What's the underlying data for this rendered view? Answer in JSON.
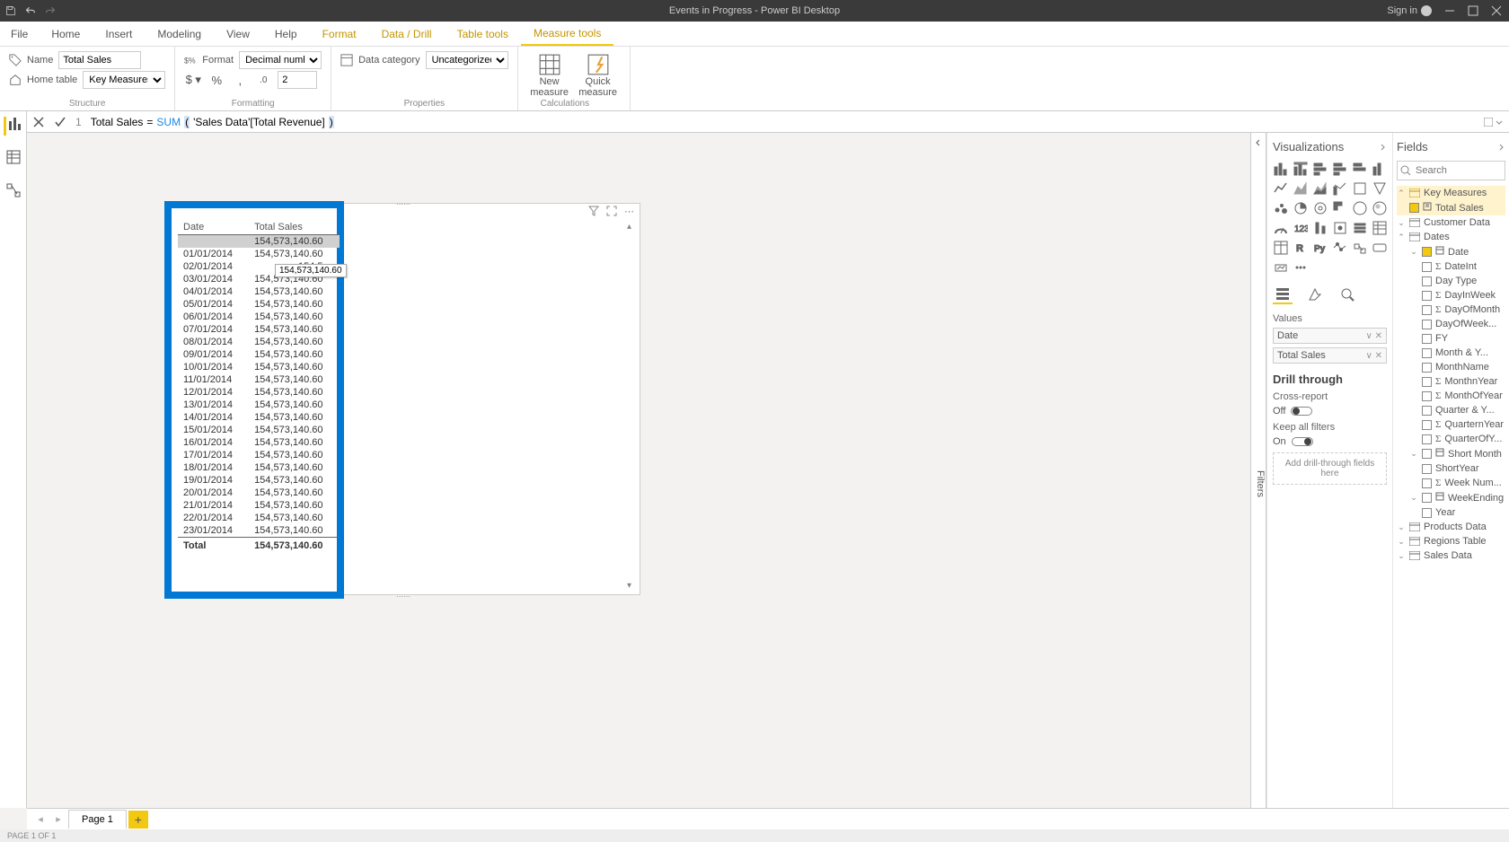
{
  "title_bar": {
    "title": "Events in Progress - Power BI Desktop",
    "sign_in": "Sign in"
  },
  "ribbon_tabs": {
    "file": "File",
    "home": "Home",
    "insert": "Insert",
    "modeling": "Modeling",
    "view": "View",
    "help": "Help",
    "format": "Format",
    "data_drill": "Data / Drill",
    "table_tools": "Table tools",
    "measure_tools": "Measure tools"
  },
  "ribbon": {
    "structure": {
      "name_label": "Name",
      "name_value": "Total Sales",
      "home_table_label": "Home table",
      "home_table_value": "Key Measures",
      "group": "Structure"
    },
    "formatting": {
      "format_label": "Format",
      "format_value": "Decimal number",
      "decimals": "2",
      "group": "Formatting"
    },
    "properties": {
      "data_cat_label": "Data category",
      "data_cat_value": "Uncategorized",
      "group": "Properties"
    },
    "calculations": {
      "new_measure": "New measure",
      "quick_measure": "Quick measure",
      "group": "Calculations"
    }
  },
  "formula": {
    "line": "1",
    "measure_name": "Total Sales",
    "eq": " = ",
    "func": "SUM",
    "open": "(",
    "arg": " 'Sales Data'[Total Revenue] ",
    "close": ")"
  },
  "visual": {
    "columns": {
      "date": "Date",
      "total_sales": "Total Sales"
    },
    "rows": [
      {
        "date": "",
        "value": "154,573,140.60",
        "selected": true
      },
      {
        "date": "01/01/2014",
        "value": "154,573,140.60"
      },
      {
        "date": "02/01/2014",
        "value": "154,5"
      },
      {
        "date": "03/01/2014",
        "value": "154,573,140.60"
      },
      {
        "date": "04/01/2014",
        "value": "154,573,140.60"
      },
      {
        "date": "05/01/2014",
        "value": "154,573,140.60"
      },
      {
        "date": "06/01/2014",
        "value": "154,573,140.60"
      },
      {
        "date": "07/01/2014",
        "value": "154,573,140.60"
      },
      {
        "date": "08/01/2014",
        "value": "154,573,140.60"
      },
      {
        "date": "09/01/2014",
        "value": "154,573,140.60"
      },
      {
        "date": "10/01/2014",
        "value": "154,573,140.60"
      },
      {
        "date": "11/01/2014",
        "value": "154,573,140.60"
      },
      {
        "date": "12/01/2014",
        "value": "154,573,140.60"
      },
      {
        "date": "13/01/2014",
        "value": "154,573,140.60"
      },
      {
        "date": "14/01/2014",
        "value": "154,573,140.60"
      },
      {
        "date": "15/01/2014",
        "value": "154,573,140.60"
      },
      {
        "date": "16/01/2014",
        "value": "154,573,140.60"
      },
      {
        "date": "17/01/2014",
        "value": "154,573,140.60"
      },
      {
        "date": "18/01/2014",
        "value": "154,573,140.60"
      },
      {
        "date": "19/01/2014",
        "value": "154,573,140.60"
      },
      {
        "date": "20/01/2014",
        "value": "154,573,140.60"
      },
      {
        "date": "21/01/2014",
        "value": "154,573,140.60"
      },
      {
        "date": "22/01/2014",
        "value": "154,573,140.60"
      },
      {
        "date": "23/01/2014",
        "value": "154,573,140.60"
      }
    ],
    "total_label": "Total",
    "total_value": "154,573,140.60",
    "tooltip": "154,573,140.60"
  },
  "filters_label": "Filters",
  "viz_pane": {
    "header": "Visualizations",
    "values_label": "Values",
    "wells": [
      {
        "name": "Date"
      },
      {
        "name": "Total Sales"
      }
    ],
    "drill_header": "Drill through",
    "cross_report": "Cross-report",
    "off": "Off",
    "keep_filters": "Keep all filters",
    "on": "On",
    "drop_hint": "Add drill-through fields here"
  },
  "fields_pane": {
    "header": "Fields",
    "search_placeholder": "Search",
    "tables": {
      "key_measures": "Key Measures",
      "total_sales": "Total Sales",
      "customer_data": "Customer Data",
      "dates": "Dates",
      "date_fields": [
        {
          "name": "Date",
          "checked": true,
          "type": "hier"
        },
        {
          "name": "DateInt",
          "checked": false,
          "type": "sigma"
        },
        {
          "name": "Day Type",
          "checked": false,
          "type": "none"
        },
        {
          "name": "DayInWeek",
          "checked": false,
          "type": "sigma"
        },
        {
          "name": "DayOfMonth",
          "checked": false,
          "type": "sigma"
        },
        {
          "name": "DayOfWeek...",
          "checked": false,
          "type": "none"
        },
        {
          "name": "FY",
          "checked": false,
          "type": "none"
        },
        {
          "name": "Month & Y...",
          "checked": false,
          "type": "none"
        },
        {
          "name": "MonthName",
          "checked": false,
          "type": "none"
        },
        {
          "name": "MonthnYear",
          "checked": false,
          "type": "sigma"
        },
        {
          "name": "MonthOfYear",
          "checked": false,
          "type": "sigma"
        },
        {
          "name": "Quarter & Y...",
          "checked": false,
          "type": "none"
        },
        {
          "name": "QuarternYear",
          "checked": false,
          "type": "sigma"
        },
        {
          "name": "QuarterOfY...",
          "checked": false,
          "type": "sigma"
        },
        {
          "name": "Short Month",
          "checked": false,
          "type": "hier"
        },
        {
          "name": "ShortYear",
          "checked": false,
          "type": "none"
        },
        {
          "name": "Week Num...",
          "checked": false,
          "type": "sigma"
        },
        {
          "name": "WeekEnding",
          "checked": false,
          "type": "hier-expand"
        },
        {
          "name": "Year",
          "checked": false,
          "type": "none"
        }
      ],
      "products_data": "Products Data",
      "regions_table": "Regions Table",
      "sales_data": "Sales Data"
    }
  },
  "page_tabs": {
    "page1": "Page 1"
  },
  "status": "PAGE 1 OF 1"
}
